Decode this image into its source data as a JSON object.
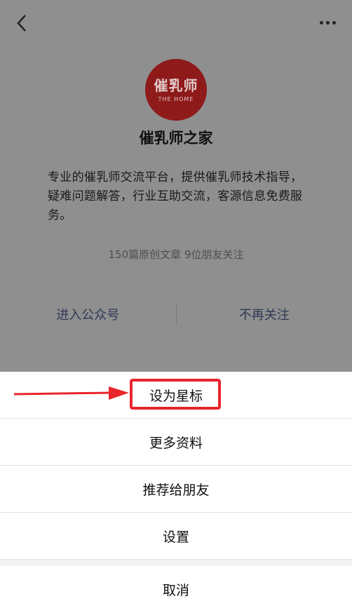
{
  "profile": {
    "logo_text": "催乳师",
    "logo_subtext": "THE HOME",
    "name": "催乳师之家",
    "description": "专业的催乳师交流平台，提供催乳师技术指导，疑难问题解答，行业互助交流，客源信息免费服务。",
    "stats": "150篇原创文章  9位朋友关注",
    "enter_label": "进入公众号",
    "unfollow_label": "不再关注"
  },
  "sheet": {
    "items": [
      "设为星标",
      "更多资料",
      "推荐给朋友",
      "设置"
    ],
    "cancel": "取消"
  },
  "colors": {
    "highlight": "#e8262c",
    "link": "#2f3a55",
    "logo": "#8f1a1a"
  }
}
